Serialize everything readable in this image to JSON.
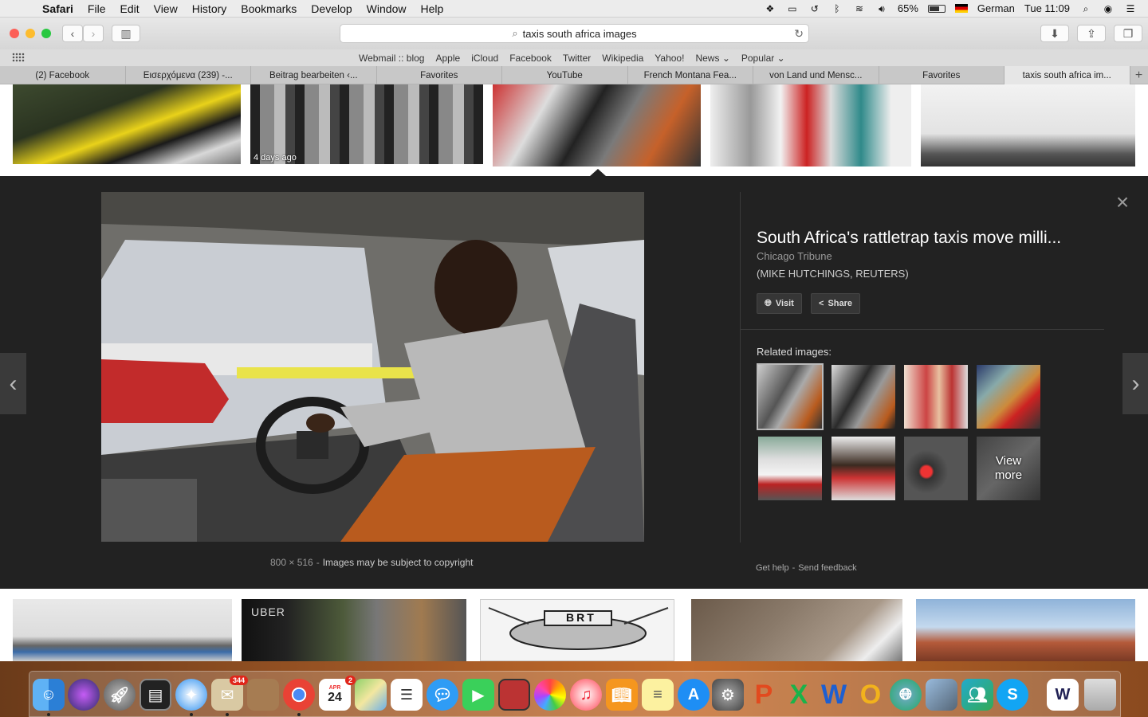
{
  "menubar": {
    "app": "Safari",
    "items": [
      "File",
      "Edit",
      "View",
      "History",
      "Bookmarks",
      "Develop",
      "Window",
      "Help"
    ],
    "battery": "65%",
    "battery_level": 0.65,
    "language": "German",
    "clock": "Tue 11:09"
  },
  "toolbar": {
    "address": "taxis south africa images"
  },
  "favorites": [
    "Webmail :: blog",
    "Apple",
    "iCloud",
    "Facebook",
    "Twitter",
    "Wikipedia",
    "Yahoo!",
    "News",
    "Popular"
  ],
  "tabs": [
    "(2) Facebook",
    "Εισερχόμενα (239) -...",
    "Beitrag bearbeiten ‹...",
    "Favorites",
    "YouTube",
    "French Montana Fea...",
    "von Land und Mensc...",
    "Favorites",
    "taxis south africa im..."
  ],
  "results": {
    "top_caption": "4 days ago"
  },
  "panel": {
    "title": "South Africa's rattletrap taxis move milli...",
    "source": "Chicago Tribune",
    "credit": "(MIKE HUTCHINGS, REUTERS)",
    "visit_label": "Visit",
    "share_label": "Share",
    "related_label": "Related images:",
    "view_more_line1": "View",
    "view_more_line2": "more",
    "dimensions": "800 × 516",
    "copyright": "Images may be subject to copyright",
    "get_help": "Get help",
    "send_feedback": "Send feedback"
  },
  "dock": {
    "photos_badge": "344",
    "calendar_month": "APR",
    "calendar_day": "24",
    "calendar_badge": "2"
  }
}
